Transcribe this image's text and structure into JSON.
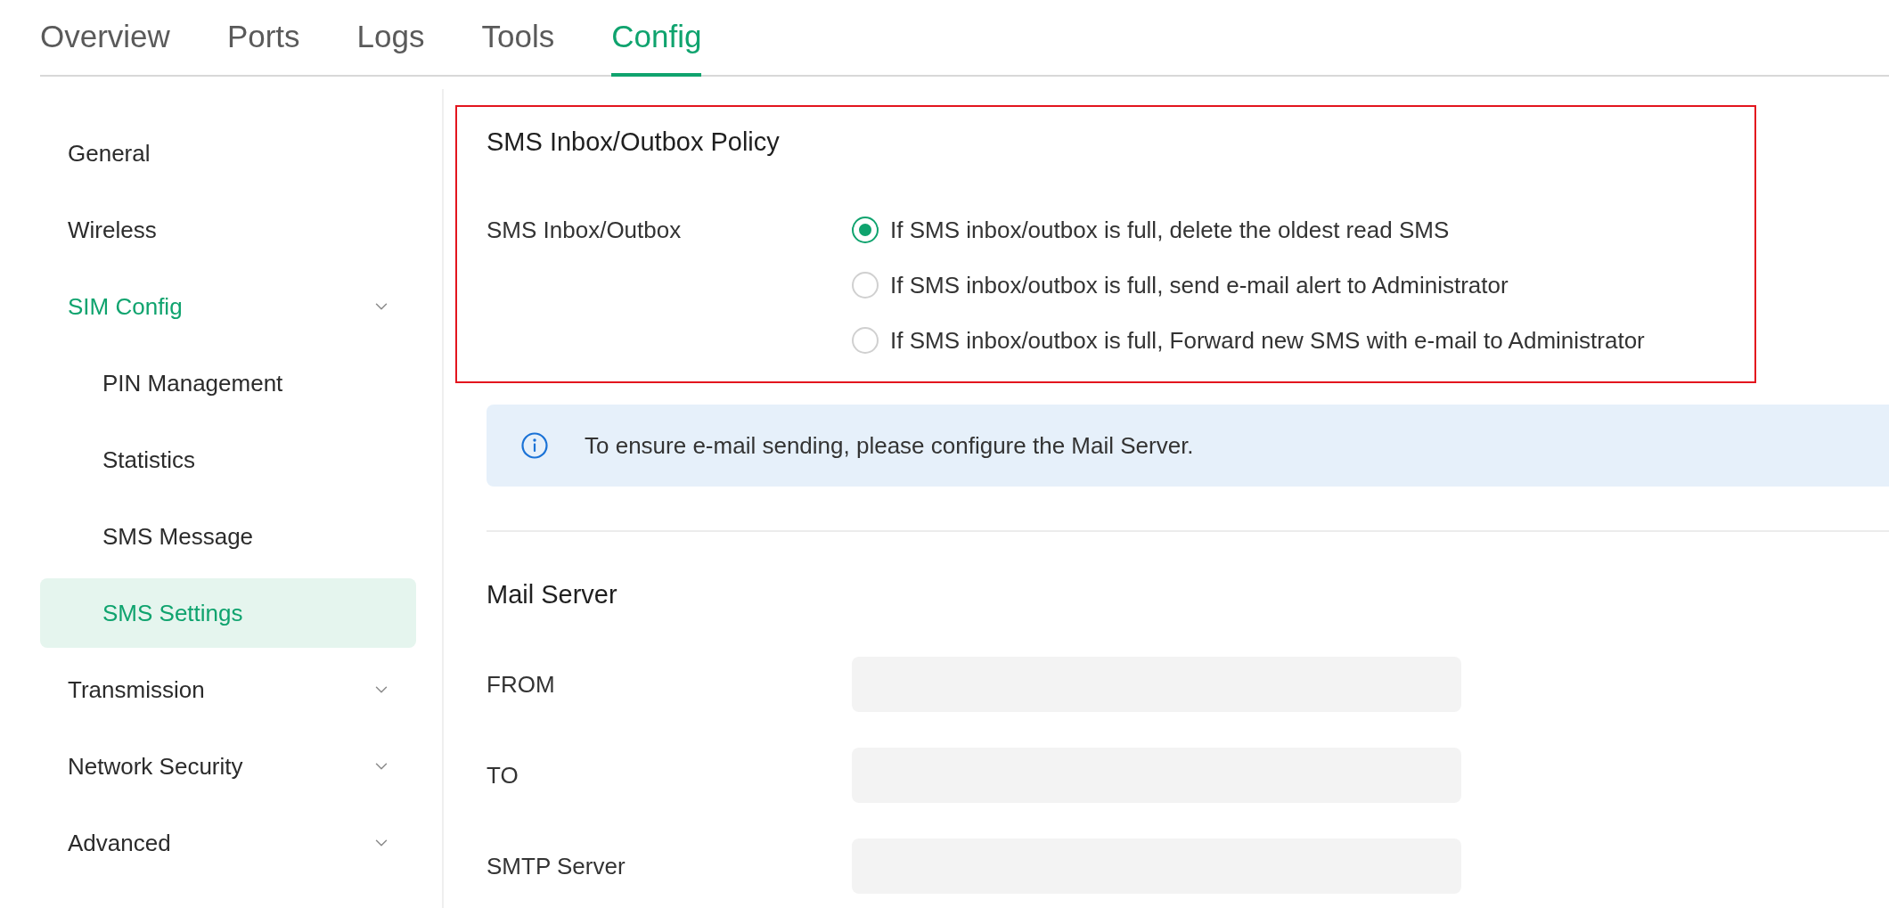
{
  "tabs": [
    {
      "label": "Overview",
      "selected": false
    },
    {
      "label": "Ports",
      "selected": false
    },
    {
      "label": "Logs",
      "selected": false
    },
    {
      "label": "Tools",
      "selected": false
    },
    {
      "label": "Config",
      "selected": true
    }
  ],
  "sidebar": {
    "items": [
      {
        "label": "General",
        "kind": "item",
        "selected": false
      },
      {
        "label": "Wireless",
        "kind": "item",
        "selected": false
      },
      {
        "label": "SIM Config",
        "kind": "group",
        "selected": false,
        "children": [
          {
            "label": "PIN Management",
            "selected": false
          },
          {
            "label": "Statistics",
            "selected": false
          },
          {
            "label": "SMS Message",
            "selected": false
          },
          {
            "label": "SMS Settings",
            "selected": true
          }
        ]
      },
      {
        "label": "Transmission",
        "kind": "group",
        "selected": false
      },
      {
        "label": "Network Security",
        "kind": "group",
        "selected": false
      },
      {
        "label": "Advanced",
        "kind": "group",
        "selected": false
      }
    ]
  },
  "policy": {
    "title": "SMS Inbox/Outbox Policy",
    "label": "SMS Inbox/Outbox",
    "options": [
      {
        "label": "If SMS inbox/outbox is full, delete the oldest read SMS",
        "selected": true
      },
      {
        "label": "If SMS inbox/outbox is full, send e-mail alert to Administrator",
        "selected": false
      },
      {
        "label": "If SMS inbox/outbox is full, Forward new SMS with e-mail to Administrator",
        "selected": false
      }
    ]
  },
  "notice": {
    "text": "To ensure e-mail sending, please configure the Mail Server."
  },
  "mail_server": {
    "title": "Mail Server",
    "fields": [
      {
        "label": "FROM"
      },
      {
        "label": "TO"
      },
      {
        "label": "SMTP Server"
      }
    ]
  }
}
